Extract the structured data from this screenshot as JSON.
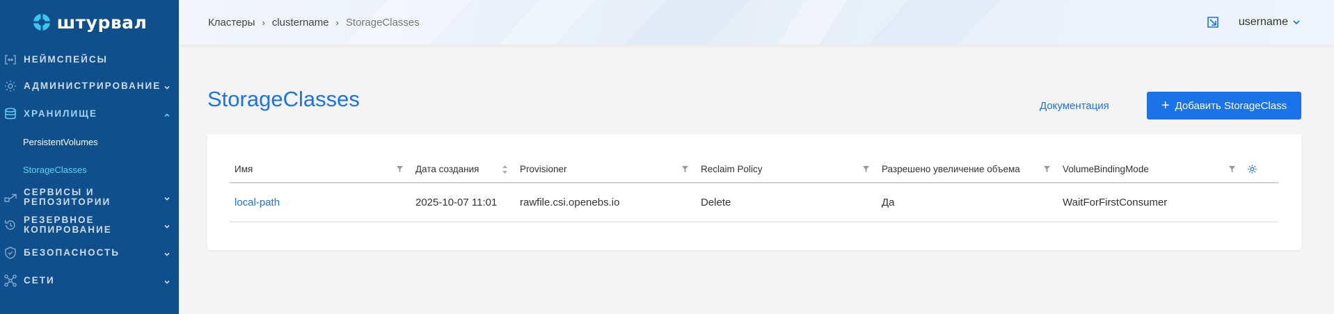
{
  "brand": {
    "name": "штурвал"
  },
  "sidebar": {
    "items": [
      {
        "label": "НЕЙМСПЕЙСЫ",
        "icon": "namespace-icon",
        "has_chevron": false
      },
      {
        "label": "АДМИНИСТРИРОВАНИЕ",
        "icon": "gear-icon",
        "has_chevron": true,
        "chevron": "down"
      },
      {
        "label": "ХРАНИЛИЩЕ",
        "icon": "database-icon",
        "has_chevron": true,
        "chevron": "up",
        "active": true
      },
      {
        "label": "СЕРВИСЫ И РЕПОЗИТОРИИ",
        "icon": "services-icon",
        "has_chevron": true,
        "chevron": "down"
      },
      {
        "label": "РЕЗЕРВНОЕ КОПИРОВАНИЕ",
        "icon": "backup-icon",
        "has_chevron": true,
        "chevron": "down"
      },
      {
        "label": "БЕЗОПАСНОСТЬ",
        "icon": "shield-icon",
        "has_chevron": true,
        "chevron": "down"
      },
      {
        "label": "СЕТИ",
        "icon": "network-icon",
        "has_chevron": true,
        "chevron": "down"
      }
    ],
    "storage_sub": [
      {
        "label": "PersistentVolumes"
      },
      {
        "label": "StorageClasses",
        "active": true
      }
    ]
  },
  "header": {
    "breadcrumb": [
      "Кластеры",
      "clustername",
      "StorageClasses"
    ],
    "username": "username"
  },
  "main": {
    "title": "StorageClasses",
    "doc_link": "Документация",
    "add_button": "Добавить StorageClass"
  },
  "table": {
    "columns": [
      "Имя",
      "Дата создания",
      "Provisioner",
      "Reclaim Policy",
      "Разрешено увеличение объема",
      "VolumeBindingMode"
    ],
    "rows": [
      [
        "local-path",
        "2025-10-07 11:01",
        "rawfile.csi.openebs.io",
        "Delete",
        "Да",
        "WaitForFirstConsumer"
      ]
    ]
  },
  "colors": {
    "sidebar_bg": "#0f4f8c",
    "accent": "#1a73e8",
    "active_sub": "#5ed6f5"
  }
}
